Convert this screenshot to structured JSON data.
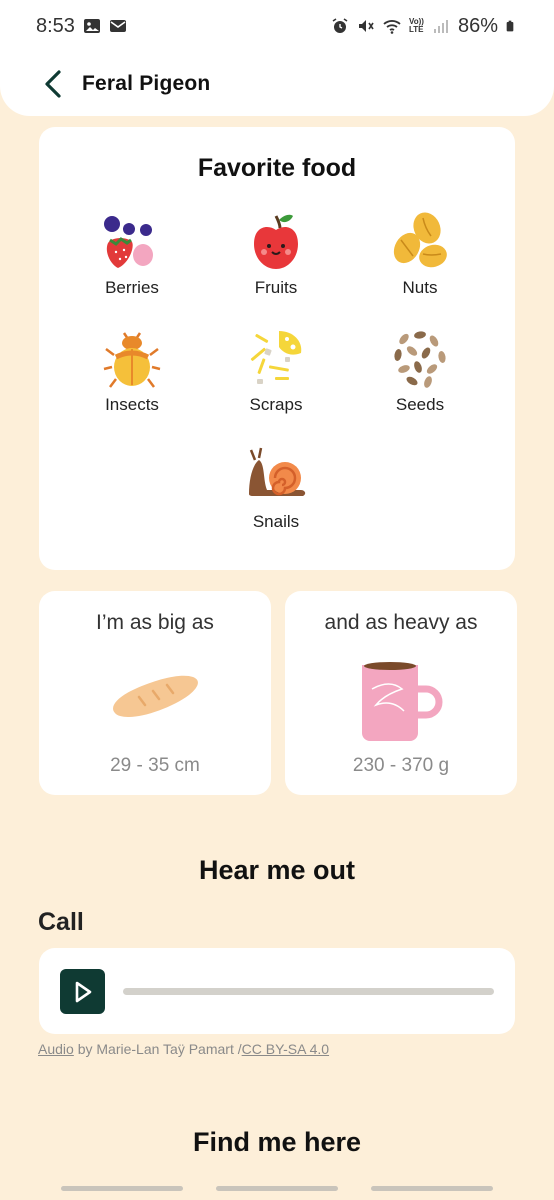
{
  "status_bar": {
    "time": "8:53",
    "battery": "86%",
    "icons_left": [
      "image-icon",
      "mail-icon"
    ],
    "icons_right": [
      "alarm-icon",
      "mute-icon",
      "wifi-icon",
      "volte-icon",
      "signal-icon",
      "battery-icon"
    ],
    "volte_text_top": "Vo))",
    "volte_text_bottom": "LTE"
  },
  "app_bar": {
    "title": "Feral Pigeon"
  },
  "favorite_food": {
    "title": "Favorite food",
    "items": [
      {
        "label": "Berries",
        "icon": "berries-icon"
      },
      {
        "label": "Fruits",
        "icon": "apple-icon"
      },
      {
        "label": "Nuts",
        "icon": "nuts-icon"
      },
      {
        "label": "Insects",
        "icon": "beetle-icon"
      },
      {
        "label": "Scraps",
        "icon": "scraps-icon"
      },
      {
        "label": "Seeds",
        "icon": "seeds-icon"
      },
      {
        "label": "Snails",
        "icon": "snail-icon"
      }
    ]
  },
  "size": {
    "big_title": "I’m as big as",
    "big_value": "29 - 35 cm",
    "heavy_title": "and as heavy as",
    "heavy_value": "230 - 370 g"
  },
  "hear_me_out": {
    "title": "Hear me out",
    "call_label": "Call",
    "progress": 0,
    "credit_audio": "Audio",
    "credit_middle": " by Marie-Lan Taÿ Pamart /",
    "credit_license": "CC BY-SA 4.0"
  },
  "find_me_here": {
    "title": "Find me here"
  },
  "colors": {
    "background": "#fdefd9",
    "accent": "#0f3a33",
    "card": "#ffffff"
  }
}
